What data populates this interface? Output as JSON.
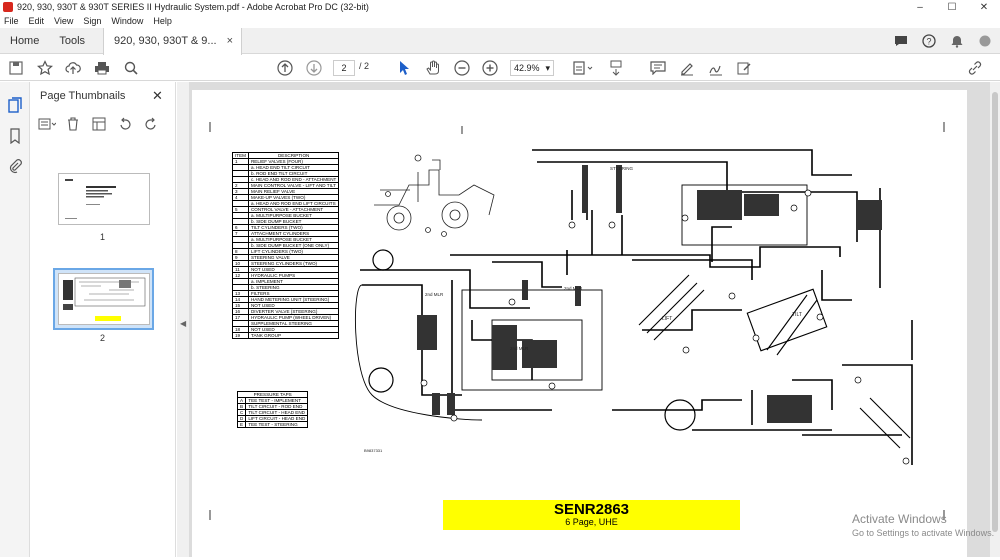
{
  "window": {
    "title": "920, 930, 930T & 930T SERIES II Hydraulic System.pdf - Adobe Acrobat Pro DC (32-bit)",
    "minimize": "–",
    "maximize": "☐",
    "close": "✕"
  },
  "menu": [
    "File",
    "Edit",
    "View",
    "Sign",
    "Window",
    "Help"
  ],
  "tabs": {
    "home": "Home",
    "tools": "Tools",
    "document": "920, 930, 930T & 9...",
    "close": "×"
  },
  "toolbar": {
    "current_page": "2",
    "total_pages": "/ 2",
    "zoom": "42.9%",
    "zoom_caret": "▾"
  },
  "thumbnails": {
    "heading": "Page Thumbnails",
    "close": "✕",
    "pages": [
      {
        "label": "1",
        "selected": false
      },
      {
        "label": "2",
        "selected": true
      }
    ]
  },
  "document": {
    "item_table": {
      "header": [
        "ITEM",
        "DESCRIPTION"
      ],
      "rows": [
        [
          "1",
          "RELIEF VALVES (FOUR)"
        ],
        [
          "",
          "a. HEAD END TILT CIRCUIT"
        ],
        [
          "",
          "b. ROD END TILT CIRCUIT"
        ],
        [
          "",
          "c. HEAD AND ROD END - ATTACHMENT"
        ],
        [
          "2",
          "MAIN CONTROL VALVE - LIFT AND TILT"
        ],
        [
          "3",
          "MAIN RELIEF VALVE"
        ],
        [
          "4",
          "MAKE-UP VALVES (TWO)"
        ],
        [
          "",
          "a. HEAD AND ROD END LIFT CIRCUITS"
        ],
        [
          "5",
          "CONTROL VALVE - ATTACHMENT"
        ],
        [
          "",
          "a. MULTIPURPOSE BUCKET"
        ],
        [
          "",
          "b. SIDE DUMP BUCKET"
        ],
        [
          "6",
          "TILT CYLINDERS (TWO)"
        ],
        [
          "7",
          "ATTACHMENT CYLINDERS"
        ],
        [
          "",
          "a. MULTIPURPOSE BUCKET"
        ],
        [
          "",
          "b. SIDE DUMP BUCKET (ONE ONLY)"
        ],
        [
          "8",
          "LIFT CYLINDERS (TWO)"
        ],
        [
          "9",
          "STEERING VALVE"
        ],
        [
          "10",
          "STEERING CYLINDERS (TWO)"
        ],
        [
          "11",
          "NOT USED"
        ],
        [
          "12",
          "HYDRAULIC PUMPS"
        ],
        [
          "",
          "a. IMPLEMENT"
        ],
        [
          "",
          "b. STEERING"
        ],
        [
          "13",
          "FILTERS"
        ],
        [
          "14",
          "HAND METERING UNIT (STEERING)"
        ],
        [
          "15",
          "NOT USED"
        ],
        [
          "16",
          "DIVERTER VALVE (STEERING)"
        ],
        [
          "17",
          "HYDRAULIC PUMP (WHEEL DRIVEN)"
        ],
        [
          "",
          "SUPPLEMENTAL STEERING"
        ],
        [
          "18",
          "NOT USED"
        ],
        [
          "19",
          "TANK GROUP"
        ]
      ]
    },
    "pressure_taps": {
      "title": "PRESSURE TAPS",
      "rows": [
        [
          "A",
          "TEE TEST - IMPLEMENT"
        ],
        [
          "B",
          "TILT CIRCUIT - ROD END"
        ],
        [
          "C",
          "TILT CIRCUIT - HEAD END"
        ],
        [
          "D",
          "LIFT CIRCUIT - HEAD END"
        ],
        [
          "E",
          "TEE TEST - STEERING"
        ]
      ]
    },
    "diagram_labels": {
      "lift": "LIFT",
      "tilt": "TILT",
      "steering": "STEERING",
      "second_mult_a": "2nd MLR",
      "second_mult_b": "2nd MLR",
      "second_mult_c": "2nd MLR",
      "drawing_no": "B9837331"
    },
    "doc_code": "SENR2863",
    "doc_sub": "6 Page, UHE"
  },
  "watermark": {
    "line1": "Activate Windows",
    "line2": "Go to Settings to activate Windows."
  },
  "colors": {
    "highlight": "#ffff00",
    "selection": "#6aa7e6"
  }
}
